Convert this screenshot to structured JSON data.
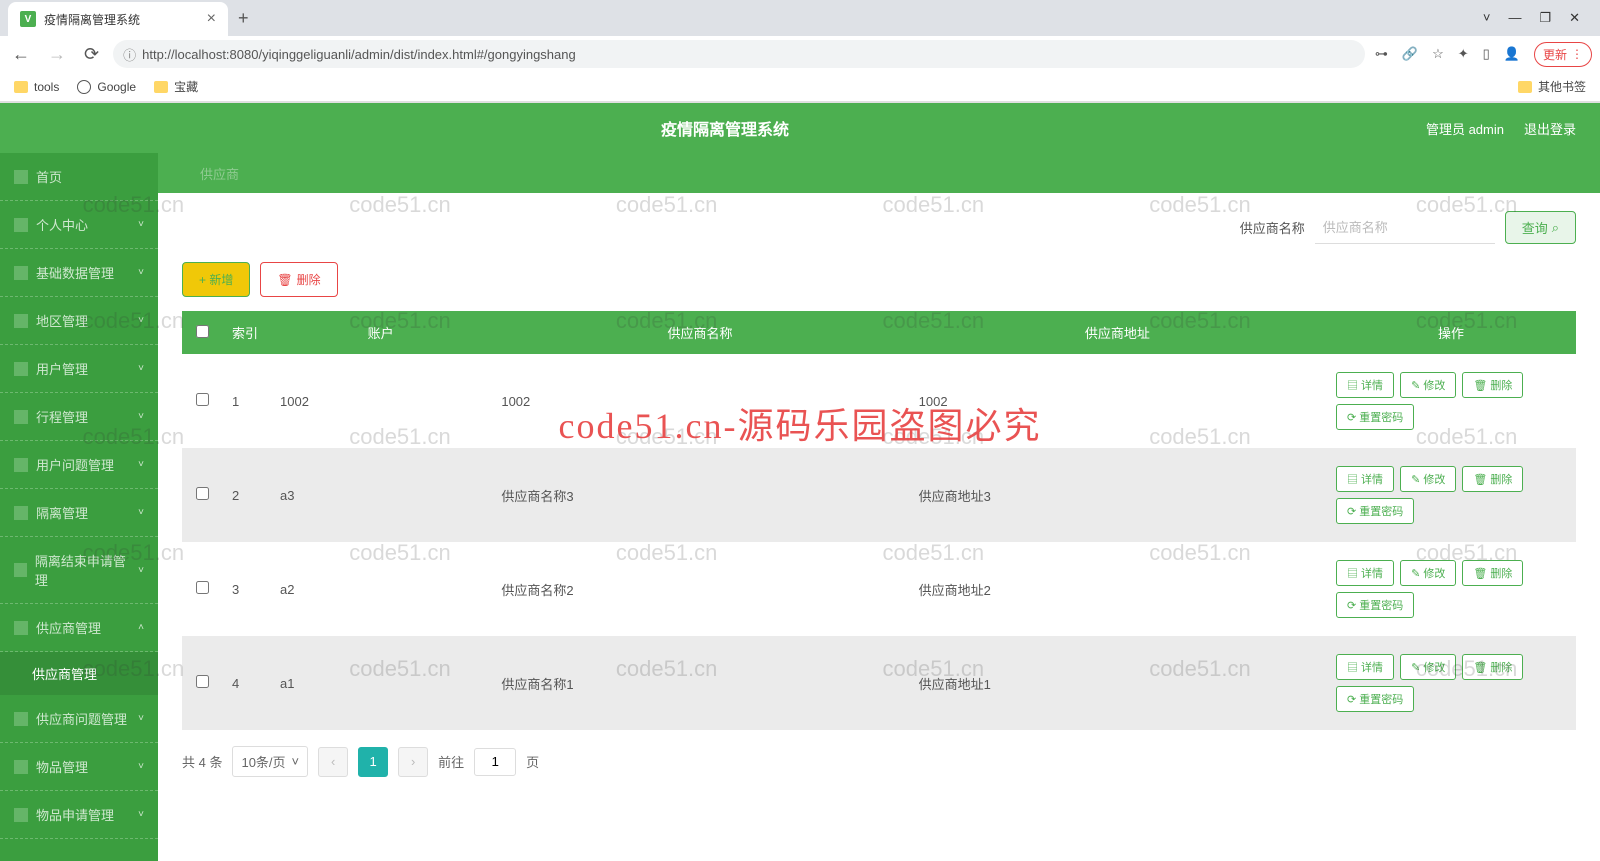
{
  "browser": {
    "tab_title": "疫情隔离管理系统",
    "url": "http://localhost:8080/yiqinggeliguanli/admin/dist/index.html#/gongyingshang",
    "update": "更新",
    "bookmarks": {
      "tools": "tools",
      "google": "Google",
      "baozang": "宝藏",
      "other": "其他书签"
    }
  },
  "header": {
    "title": "疫情隔离管理系统",
    "user": "管理员 admin",
    "logout": "退出登录"
  },
  "sidebar": {
    "items": [
      {
        "label": "首页",
        "expand": ""
      },
      {
        "label": "个人中心",
        "expand": "˅"
      },
      {
        "label": "基础数据管理",
        "expand": "˅"
      },
      {
        "label": "地区管理",
        "expand": "˅"
      },
      {
        "label": "用户管理",
        "expand": "˅"
      },
      {
        "label": "行程管理",
        "expand": "˅"
      },
      {
        "label": "用户问题管理",
        "expand": "˅"
      },
      {
        "label": "隔离管理",
        "expand": "˅"
      },
      {
        "label": "隔离结束申请管理",
        "expand": "˅"
      },
      {
        "label": "供应商管理",
        "expand": "˄"
      },
      {
        "label": "供应商问题管理",
        "expand": "˅"
      },
      {
        "label": "物品管理",
        "expand": "˅"
      },
      {
        "label": "物品申请管理",
        "expand": "˅"
      }
    ],
    "sub": "供应商管理"
  },
  "breadcrumb": "供应商",
  "search": {
    "label": "供应商名称",
    "placeholder": "供应商名称",
    "button": "查询"
  },
  "actions": {
    "add": "新增",
    "delete": "删除"
  },
  "table": {
    "headers": {
      "index": "索引",
      "account": "账户",
      "name": "供应商名称",
      "address": "供应商地址",
      "op": "操作"
    },
    "rows": [
      {
        "idx": "1",
        "account": "1002",
        "name": "1002",
        "address": "1002"
      },
      {
        "idx": "2",
        "account": "a3",
        "name": "供应商名称3",
        "address": "供应商地址3"
      },
      {
        "idx": "3",
        "account": "a2",
        "name": "供应商名称2",
        "address": "供应商地址2"
      },
      {
        "idx": "4",
        "account": "a1",
        "name": "供应商名称1",
        "address": "供应商地址1"
      }
    ],
    "ops": {
      "detail": "详情",
      "edit": "修改",
      "delete": "删除",
      "reset": "重置密码"
    }
  },
  "pager": {
    "total": "共 4 条",
    "size": "10条/页",
    "goto": "前往",
    "page": "1",
    "unit": "页"
  },
  "watermark": {
    "text": "code51.cn",
    "big": "code51.cn-源码乐园盗图必究"
  }
}
